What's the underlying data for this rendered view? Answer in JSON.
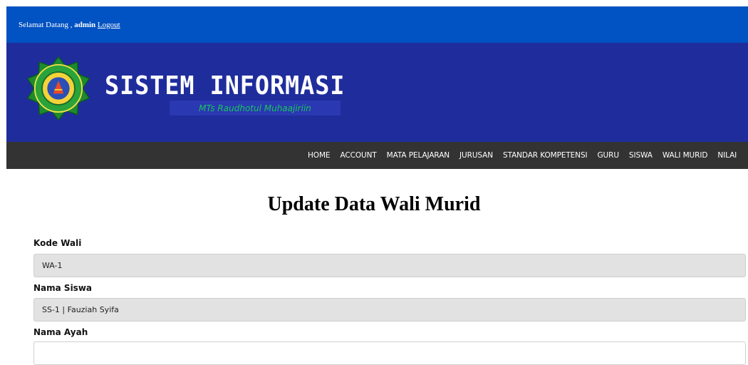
{
  "topbar": {
    "welcome_text": "Selamat Datang ,",
    "username": "admin",
    "logout_label": "Logout"
  },
  "banner": {
    "title": "SISTEM INFORMASI",
    "subtitle": "MTs Raudhotul Muhaajiriin"
  },
  "nav": {
    "items": [
      "HOME",
      "ACCOUNT",
      "MATA PELAJARAN",
      "JURUSAN",
      "STANDAR KOMPETENSI",
      "GURU",
      "SISWA",
      "WALI MURID",
      "NILAI"
    ]
  },
  "page": {
    "title": "Update Data Wali Murid"
  },
  "form": {
    "kode_wali": {
      "label": "Kode Wali",
      "value": "WA-1"
    },
    "nama_siswa": {
      "label": "Nama Siswa",
      "value": "SS-1 | Fauziah Syifa"
    },
    "nama_ayah": {
      "label": "Nama Ayah",
      "value": ""
    }
  },
  "colors": {
    "topbar": "#0152c2",
    "banner": "#1f2d9c",
    "nav": "#333333",
    "subtitle_text": "#18c55a"
  }
}
